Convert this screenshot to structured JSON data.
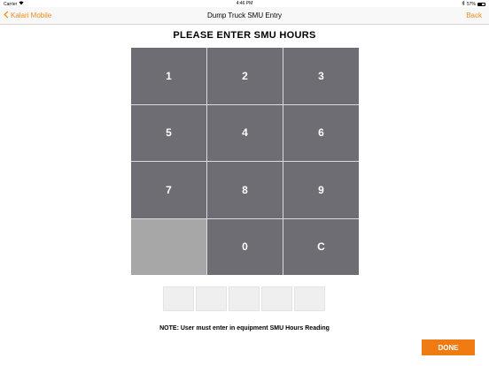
{
  "status_bar": {
    "carrier": "Carrier",
    "time": "4:46 PM",
    "battery_text": "57%",
    "battery_level": 0.57
  },
  "nav": {
    "back_label": "Kalari Mobile",
    "title": "Dump Truck SMU Entry",
    "right_label": "Back",
    "accent_color": "#f08a1c"
  },
  "heading": "PLEASE ENTER SMU HOURS",
  "keypad": {
    "keys": [
      "1",
      "2",
      "3",
      "5",
      "4",
      "6",
      "7",
      "8",
      "9",
      "",
      "0",
      "C"
    ]
  },
  "digit_entry": {
    "values": [
      "",
      "",
      "",
      "",
      ""
    ]
  },
  "note": "NOTE: User must enter in equipment SMU Hours Reading",
  "done_label": "DONE",
  "colors": {
    "key_bg": "#6e6d73",
    "blank_key_bg": "#a7a7a7",
    "done_bg": "#f07b12"
  }
}
